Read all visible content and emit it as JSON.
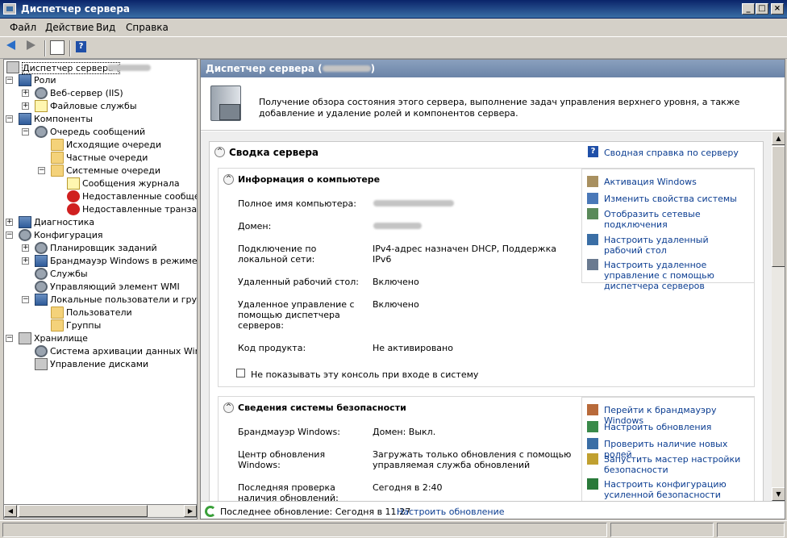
{
  "window": {
    "title": "Диспетчер сервера",
    "min": "_",
    "max": "□",
    "close": "×"
  },
  "menu": [
    "Файл",
    "Действие",
    "Вид",
    "Справка"
  ],
  "tree": [
    {
      "label": "Диспетчер сервера (",
      "level": 0,
      "exp": "",
      "icon": "server"
    },
    {
      "label": "Роли",
      "level": 1,
      "exp": "−",
      "icon": "srv2"
    },
    {
      "label": "Веб-сервер (IIS)",
      "level": 2,
      "exp": "+",
      "icon": "gear"
    },
    {
      "label": "Файловые службы",
      "level": 2,
      "exp": "+",
      "icon": "note"
    },
    {
      "label": "Компоненты",
      "level": 1,
      "exp": "−",
      "icon": "srv2"
    },
    {
      "label": "Очередь сообщений",
      "level": 2,
      "exp": "−",
      "icon": "gear"
    },
    {
      "label": "Исходящие очереди",
      "level": 3,
      "exp": "",
      "icon": "folder"
    },
    {
      "label": "Частные очереди",
      "level": 3,
      "exp": "",
      "icon": "folder"
    },
    {
      "label": "Системные очереди",
      "level": 3,
      "exp": "−",
      "icon": "folder"
    },
    {
      "label": "Сообщения журнала",
      "level": 4,
      "exp": "",
      "icon": "note"
    },
    {
      "label": "Недоставленные сообщен",
      "level": 4,
      "exp": "",
      "icon": "err"
    },
    {
      "label": "Недоставленные транзакт",
      "level": 4,
      "exp": "",
      "icon": "err"
    },
    {
      "label": "Диагностика",
      "level": 1,
      "exp": "+",
      "icon": "srv2"
    },
    {
      "label": "Конфигурация",
      "level": 1,
      "exp": "−",
      "icon": "gear"
    },
    {
      "label": "Планировщик заданий",
      "level": 2,
      "exp": "+",
      "icon": "gear"
    },
    {
      "label": "Брандмауэр Windows в режиме пов",
      "level": 2,
      "exp": "+",
      "icon": "srv2"
    },
    {
      "label": "Службы",
      "level": 2,
      "exp": "",
      "icon": "gear"
    },
    {
      "label": "Управляющий элемент WMI",
      "level": 2,
      "exp": "",
      "icon": "gear"
    },
    {
      "label": "Локальные пользователи и группы",
      "level": 2,
      "exp": "−",
      "icon": "srv2"
    },
    {
      "label": "Пользователи",
      "level": 3,
      "exp": "",
      "icon": "folder"
    },
    {
      "label": "Группы",
      "level": 3,
      "exp": "",
      "icon": "folder"
    },
    {
      "label": "Хранилище",
      "level": 1,
      "exp": "−",
      "icon": "server"
    },
    {
      "label": "Система архивации данных Windo",
      "level": 2,
      "exp": "",
      "icon": "gear"
    },
    {
      "label": "Управление дисками",
      "level": 2,
      "exp": "",
      "icon": "server"
    }
  ],
  "right": {
    "header": "Диспетчер сервера (",
    "header_close": ")",
    "intro": "Получение обзора состояния этого сервера, выполнение задач управления верхнего уровня, а также добавление и удаление ролей и компонентов сервера.",
    "summary_title": "Сводка сервера",
    "summary_help": "Сводная справка по серверу",
    "computer_info": {
      "title": "Информация о компьютере",
      "rows": [
        {
          "label": "Полное имя компьютера:",
          "value": ""
        },
        {
          "label": "Домен:",
          "value": ""
        },
        {
          "label": "Подключение по локальной сети:",
          "value": "IPv4-адрес назначен DHCP, Поддержка IPv6"
        },
        {
          "label": "Удаленный рабочий стол:",
          "value": "Включено"
        },
        {
          "label": "Удаленное управление с помощью диспетчера серверов:",
          "value": "Включено"
        },
        {
          "label": "Код продукта:",
          "value": "Не активировано"
        }
      ],
      "checkbox": "Не показывать эту консоль при входе в систему",
      "links": [
        "Активация Windows",
        "Изменить свойства системы",
        "Отобразить сетевые подключения",
        "Настроить удаленный рабочий стол",
        "Настроить удаленное управление с помощью диспетчера серверов"
      ]
    },
    "security": {
      "title": "Сведения системы безопасности",
      "rows": [
        {
          "label": "Брандмауэр Windows:",
          "value": "Домен: Выкл."
        },
        {
          "label": "Центр обновления Windows:",
          "value": "Загружать только обновления с помощью управляемая служба обновлений"
        },
        {
          "label": "Последняя проверка наличия обновлений:",
          "value": "Сегодня в 2:40"
        }
      ],
      "links": [
        "Перейти к брандмауэру Windows",
        "Настроить обновления",
        "Проверить наличие новых ролей",
        "Запустить мастер настройки безопасности",
        "Настроить конфигурацию усиленной безопасности Internet"
      ]
    },
    "status": "Последнее обновление: Сегодня в 11:27",
    "status_link": "Настроить обновление"
  }
}
